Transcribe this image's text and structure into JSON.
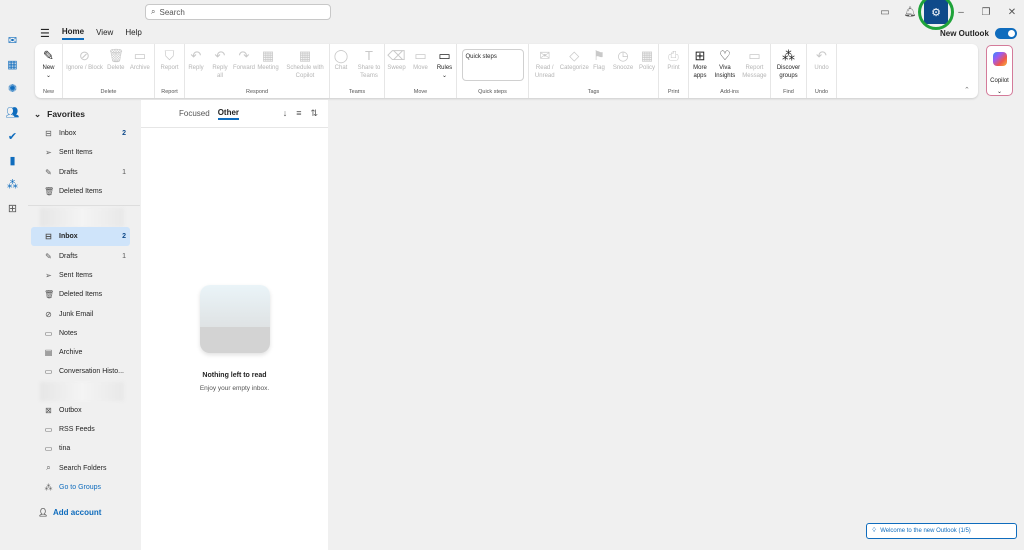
{
  "titlebar": {
    "search_placeholder": "Search",
    "icons": [
      "feedback-icon",
      "bell-icon",
      "gear-icon",
      "minimize-icon",
      "restore-icon",
      "close-icon"
    ],
    "new_outlook_label": "New Outlook",
    "new_outlook_on": true
  },
  "tabs": [
    "Home",
    "View",
    "Help"
  ],
  "active_tab": "Home",
  "rail": [
    "mail",
    "calendar",
    "copilot",
    "people",
    "todo",
    "onenote",
    "org",
    "apps"
  ],
  "ribbon": [
    {
      "label": "New",
      "buttons": [
        {
          "t": "New",
          "i": "✎",
          "dd": true
        }
      ]
    },
    {
      "label": "Delete",
      "buttons": [
        {
          "t": "Ignore / Block",
          "i": "⊘",
          "dis": true
        },
        {
          "t": "Delete",
          "i": "🗑",
          "dis": true
        },
        {
          "t": "Archive",
          "i": "▭",
          "dis": true
        }
      ]
    },
    {
      "label": "Report",
      "buttons": [
        {
          "t": "Report",
          "i": "⛉",
          "dis": true
        }
      ]
    },
    {
      "label": "Respond",
      "buttons": [
        {
          "t": "Reply",
          "i": "↶",
          "dis": true
        },
        {
          "t": "Reply all",
          "i": "↶",
          "dis": true
        },
        {
          "t": "Forward",
          "i": "↷",
          "dis": true
        },
        {
          "t": "Meeting",
          "i": "▦",
          "dis": true
        },
        {
          "t": "Schedule with Copilot",
          "i": "▦",
          "dis": true
        }
      ]
    },
    {
      "label": "Teams",
      "buttons": [
        {
          "t": "Chat",
          "i": "◯",
          "dis": true
        },
        {
          "t": "Share to Teams",
          "i": "T",
          "dis": true
        }
      ]
    },
    {
      "label": "Move",
      "buttons": [
        {
          "t": "Sweep",
          "i": "⌫",
          "dis": true
        },
        {
          "t": "Move",
          "i": "▭",
          "dis": true
        },
        {
          "t": "Rules",
          "i": "▭",
          "dd": true
        }
      ]
    },
    {
      "label": "Quick steps",
      "quick_steps": "Quick steps"
    },
    {
      "label": "Tags",
      "buttons": [
        {
          "t": "Read / Unread",
          "i": "✉",
          "dis": true
        },
        {
          "t": "Categorize",
          "i": "◇",
          "dis": true
        },
        {
          "t": "Flag",
          "i": "⚑",
          "dis": true
        },
        {
          "t": "Snooze",
          "i": "◷",
          "dis": true
        },
        {
          "t": "Policy",
          "i": "▦",
          "dis": true
        }
      ]
    },
    {
      "label": "Print",
      "buttons": [
        {
          "t": "Print",
          "i": "⎙",
          "dis": true
        }
      ]
    },
    {
      "label": "Add-ins",
      "buttons": [
        {
          "t": "More apps",
          "i": "⊞"
        },
        {
          "t": "Viva Insights",
          "i": "♡"
        },
        {
          "t": "Report Message",
          "i": "▭",
          "dis": true
        }
      ]
    },
    {
      "label": "Find",
      "buttons": [
        {
          "t": "Discover groups",
          "i": "⁂"
        }
      ]
    },
    {
      "label": "Undo",
      "buttons": [
        {
          "t": "Undo",
          "i": "↶",
          "dis": true
        }
      ]
    }
  ],
  "copilot_label": "Copilot",
  "favorites": {
    "title": "Favorites",
    "items": [
      {
        "name": "Inbox",
        "icon": "inbox",
        "count": "2"
      },
      {
        "name": "Sent Items",
        "icon": "sent"
      },
      {
        "name": "Drafts",
        "icon": "drafts",
        "count": "1"
      },
      {
        "name": "Deleted Items",
        "icon": "trash"
      }
    ]
  },
  "account_folders": [
    {
      "name": "Inbox",
      "icon": "inbox",
      "count": "2",
      "selected": true
    },
    {
      "name": "Drafts",
      "icon": "drafts",
      "count": "1"
    },
    {
      "name": "Sent Items",
      "icon": "sent"
    },
    {
      "name": "Deleted Items",
      "icon": "trash"
    },
    {
      "name": "Junk Email",
      "icon": "junk"
    },
    {
      "name": "Notes",
      "icon": "notes"
    },
    {
      "name": "Archive",
      "icon": "archive"
    },
    {
      "name": "Conversation Histo...",
      "icon": "folder"
    }
  ],
  "other_folders": [
    {
      "name": "Outbox",
      "icon": "outbox"
    },
    {
      "name": "RSS Feeds",
      "icon": "folder"
    },
    {
      "name": "tina",
      "icon": "folder"
    },
    {
      "name": "Search Folders",
      "icon": "search-folder"
    }
  ],
  "go_to_groups": "Go to Groups",
  "add_account": "Add account",
  "mail_list": {
    "tabs": [
      "Focused",
      "Other"
    ],
    "active": "Other",
    "empty_title": "Nothing left to read",
    "empty_subtitle": "Enjoy your empty inbox."
  },
  "toast": "Welcome to the new Outlook  (1/5)"
}
